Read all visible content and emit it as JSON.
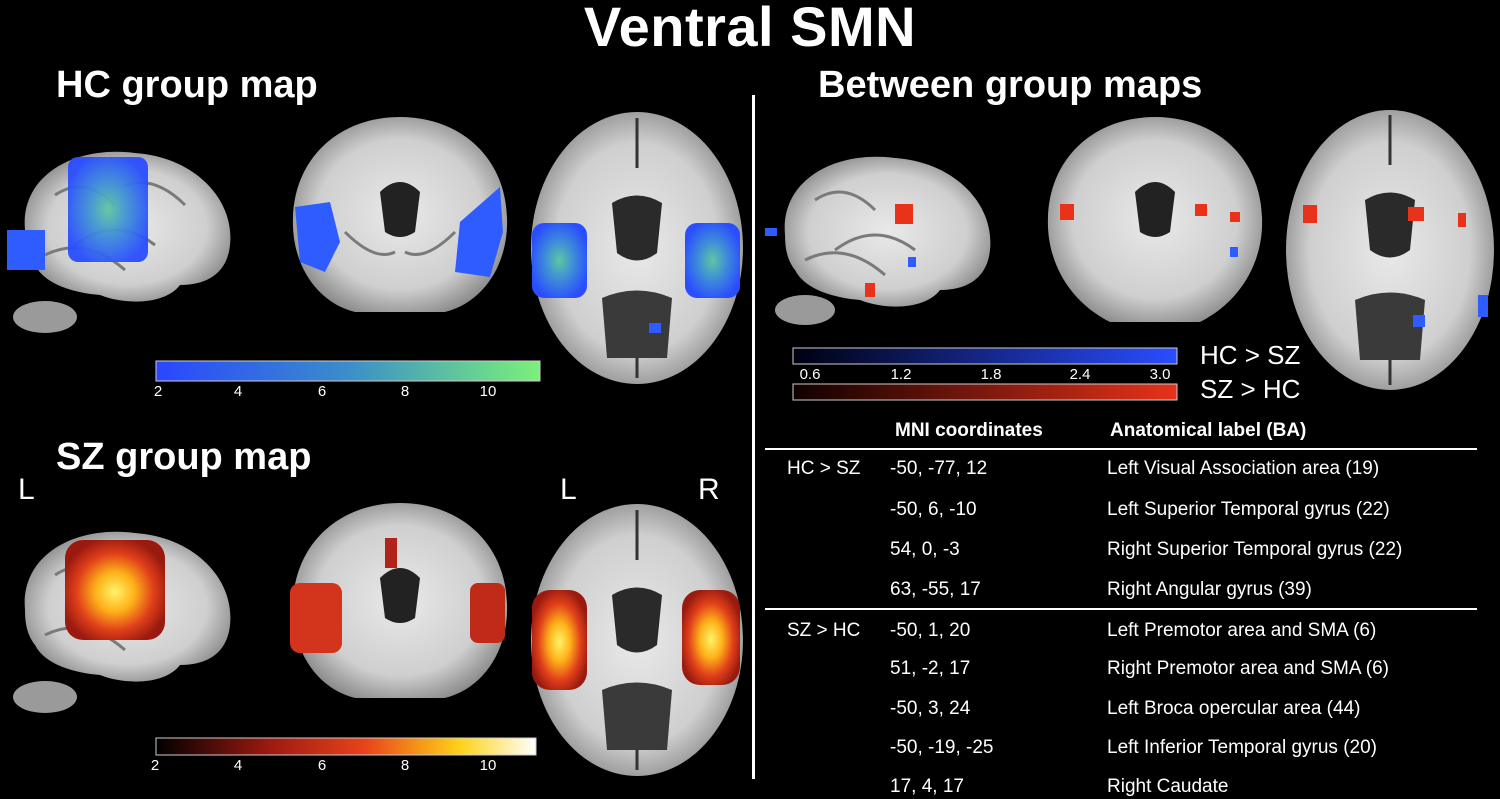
{
  "title": "Ventral SMN",
  "hc_panel": {
    "title": "HC group map",
    "colorbar_ticks": [
      "2",
      "4",
      "6",
      "8",
      "10"
    ]
  },
  "sz_panel": {
    "title": "SZ group map",
    "colorbar_ticks": [
      "2",
      "4",
      "6",
      "8",
      "10"
    ]
  },
  "between_panel": {
    "title": "Between group maps",
    "colorbar_ticks": [
      "0.6",
      "1.2",
      "1.8",
      "2.4",
      "3.0"
    ],
    "legend_blue": "HC > SZ",
    "legend_red": "SZ > HC"
  },
  "orientation": {
    "left": "L",
    "left2": "L",
    "right": "R"
  },
  "colors": {
    "blue": "#2f5cff",
    "red": "#e8321a",
    "yellow": "#ffe21a"
  },
  "table": {
    "col_mni": "MNI coordinates",
    "col_label": "Anatomical label (BA)",
    "groups": [
      {
        "name": "HC > SZ",
        "rows": [
          {
            "mni": "-50, -77, 12",
            "label": "Left Visual Association area (19)"
          },
          {
            "mni": "-50, 6, -10",
            "label": "Left Superior Temporal gyrus (22)"
          },
          {
            "mni": "54, 0, -3",
            "label": "Right Superior Temporal gyrus (22)"
          },
          {
            "mni": "63, -55, 17",
            "label": "Right Angular gyrus (39)"
          }
        ]
      },
      {
        "name": "SZ > HC",
        "rows": [
          {
            "mni": "-50, 1, 20",
            "label": "Left Premotor area and SMA (6)"
          },
          {
            "mni": "51, -2, 17",
            "label": "Right Premotor area and SMA (6)"
          },
          {
            "mni": "-50, 3, 24",
            "label": "Left Broca opercular area (44)"
          },
          {
            "mni": "-50, -19, -25",
            "label": "Left Inferior Temporal gyrus (20)"
          },
          {
            "mni": "17, 4, 17",
            "label": "Right Caudate"
          }
        ]
      }
    ]
  }
}
